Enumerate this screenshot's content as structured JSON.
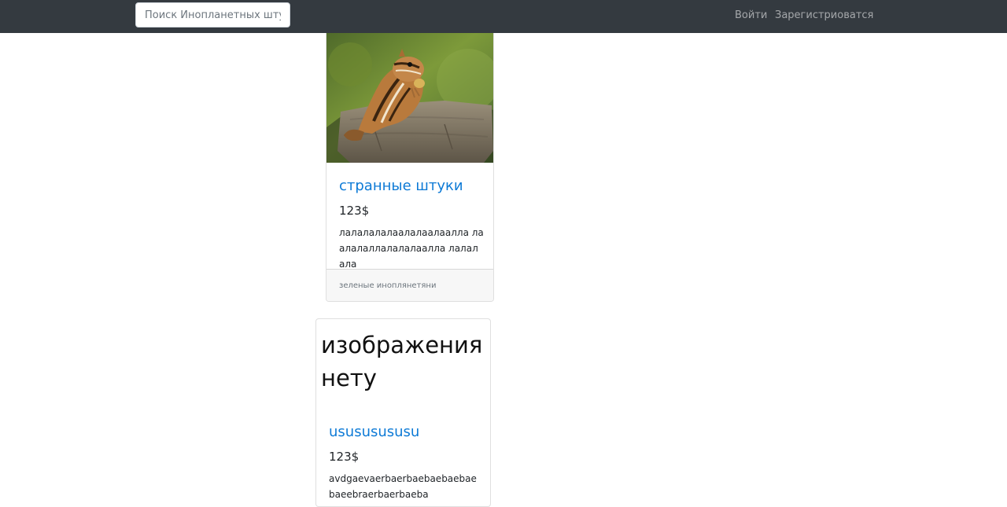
{
  "navbar": {
    "search_placeholder": "Поиск Инопланетных штук",
    "login_label": "Войти",
    "register_label": "Зарегистриоватся"
  },
  "cards": [
    {
      "image_alt": "chipmunk",
      "title": "странные штуки",
      "price": "123$",
      "description": "лалалалалаалалаалаалла лаалалаллалалалаалла лалалала",
      "footer": "зеленые иноплянетяни"
    },
    {
      "no_image_text": "изображения нету",
      "title": "usususususu",
      "price": "123$",
      "description": "avdgaevaerbaerbaebaebaebaebaeebraerbaerbaeba"
    }
  ],
  "colors": {
    "navbar_bg": "#343a40",
    "title_link": "#0d7ad6",
    "footer_bg": "#f7f7f7"
  }
}
